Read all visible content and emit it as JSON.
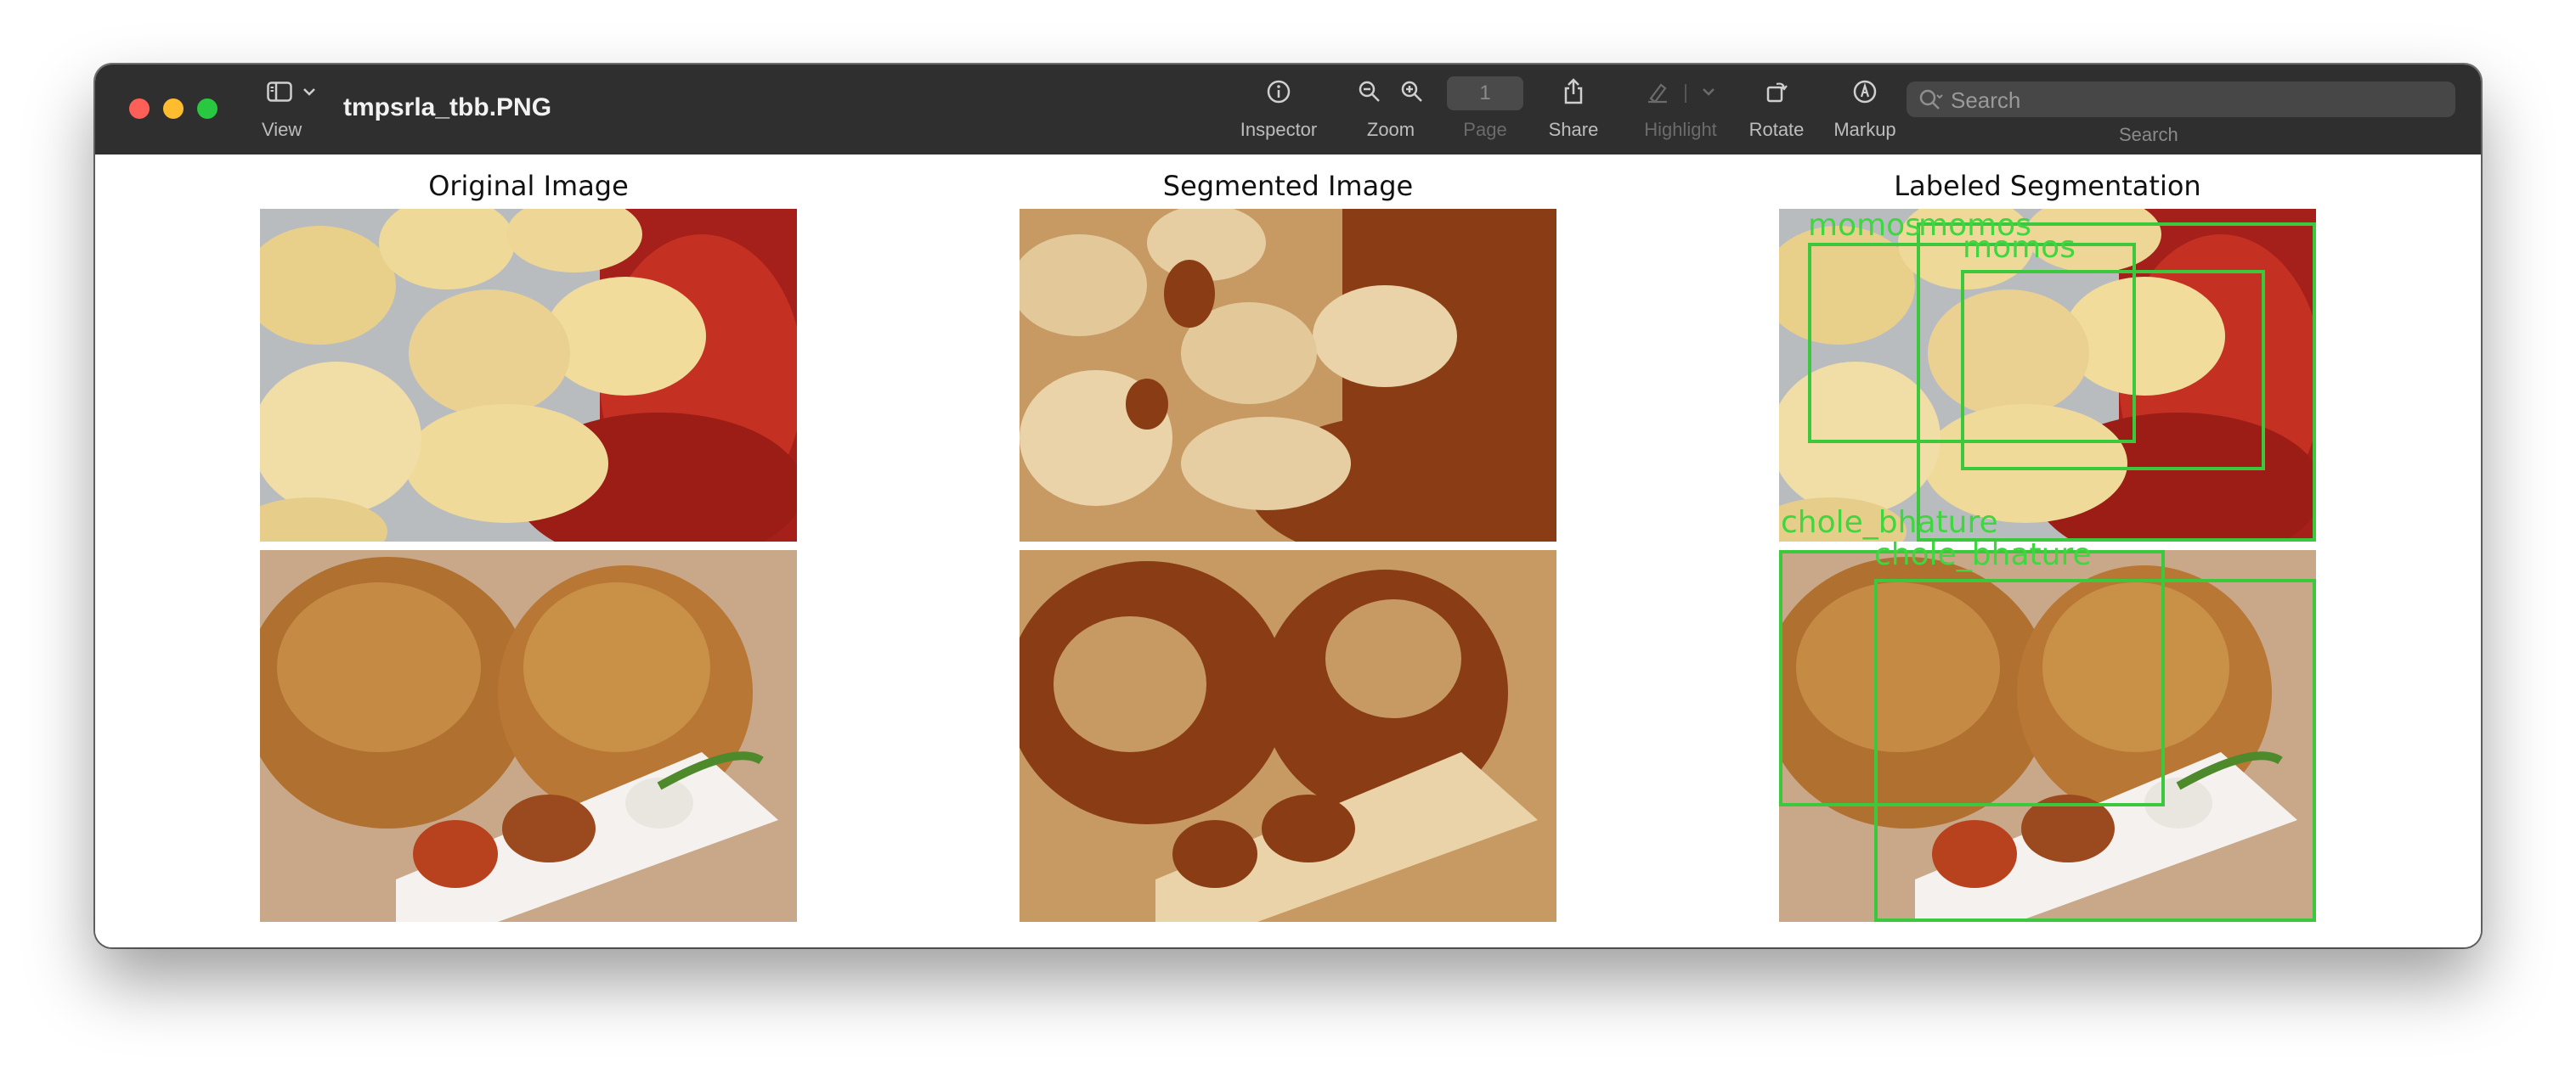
{
  "window": {
    "title": "tmpsrla_tbb.PNG"
  },
  "toolbar": {
    "view_label": "View",
    "inspector_label": "Inspector",
    "zoom_label": "Zoom",
    "page_label": "Page",
    "page_value": "1",
    "share_label": "Share",
    "highlight_label": "Highlight",
    "rotate_label": "Rotate",
    "markup_label": "Markup",
    "search_placeholder": "Search",
    "search_label": "Search"
  },
  "icons": {
    "sidebar": "sidebar-icon",
    "chevron": "chevron-down-icon",
    "inspector": "info-icon",
    "zoom_out": "zoom-out-icon",
    "zoom_in": "zoom-in-icon",
    "share": "share-icon",
    "highlight": "highlighter-icon",
    "rotate": "rotate-icon",
    "markup": "markup-pen-icon",
    "search": "magnifier-icon"
  },
  "figure": {
    "panels": [
      {
        "title": "Original Image"
      },
      {
        "title": "Segmented Image"
      },
      {
        "title": "Labeled Segmentation"
      }
    ],
    "labels": [
      "momos",
      "momos",
      "momos",
      "chole_bhature",
      "chole_bhature"
    ]
  },
  "colors": {
    "titlebar": "#2f2f2f",
    "box_outline": "#3cc83c",
    "label_text": "#3fd63f"
  }
}
